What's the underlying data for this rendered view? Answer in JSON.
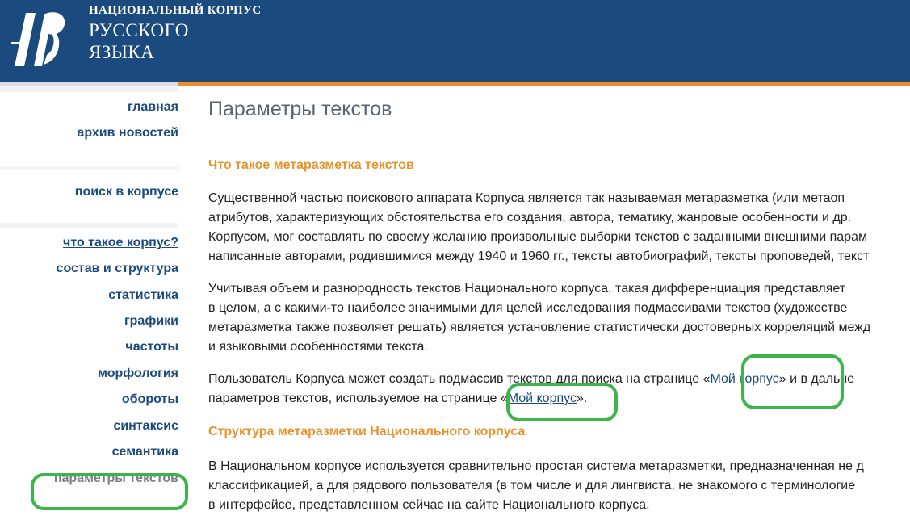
{
  "logo": {
    "line1": "НАЦИОНАЛЬНЫЙ КОРПУС",
    "line2": "РУССКОГО",
    "line3": "ЯЗЫКА",
    "icon": "corpus-logo-icon"
  },
  "sidebar": {
    "items": [
      {
        "label": "главная"
      },
      {
        "label": "архив новостей"
      },
      {
        "label": "поиск в корпусе"
      },
      {
        "label": "что такое корпус?"
      },
      {
        "label": "состав и структура"
      },
      {
        "label": "статистика"
      },
      {
        "label": "графики"
      },
      {
        "label": "частоты"
      },
      {
        "label": "морфология"
      },
      {
        "label": "обороты"
      },
      {
        "label": "синтаксис"
      },
      {
        "label": "семантика"
      },
      {
        "label": "параметры текстов"
      }
    ]
  },
  "main": {
    "title": "Параметры текстов",
    "section1": "Что такое метаразметка текстов",
    "p1": [
      "Существенной частью поискового аппарата Корпуса является так называемая метаразметка (или метаоп",
      "атрибутов, характеризующих обстоятельства его создания, автора, тематику, жанровые особенности и др.",
      "Корпусом, мог составлять по своему желанию произвольные выборки текстов с заданными внешними парам",
      "написанные авторами, родившимися между 1940 и 1960 гг., тексты автобиографий, тексты проповедей, текст"
    ],
    "p2": [
      "Учитывая объем и разнородность текстов Национального корпуса, такая дифференциация представляет",
      "в целом, а с какими-то наиболее значимыми для целей исследования подмассивами текстов (художестве",
      "метаразметка также позволяет решать) является установление статистически достоверных корреляций межд",
      "и языковыми особенностями текста."
    ],
    "p3": {
      "line1_before": "Пользователь Корпуса может создать подмассив текстов для поиска на странице «",
      "link1": "Мой корпус",
      "line1_after": "» и в дальне",
      "line2_before": "параметров текстов, используемое на странице «",
      "link2": "Мой корпус",
      "line2_after": "»."
    },
    "section2": "Структура метаразметки Национального корпуса",
    "p4": [
      "В Национальном корпусе используется сравнительно простая система метаразметки, предназначенная не д",
      "классификацией, а для рядового пользователя (в том числе и для лингвиста, не знакомого с терминологие",
      "в интерфейсе, представленном сейчас на сайте Национального корпуса."
    ]
  },
  "colors": {
    "header": "#1b4a7e",
    "accent_orange": "#e8922c",
    "highlight_green": "#3eb54b",
    "link": "#1b4a7e"
  }
}
